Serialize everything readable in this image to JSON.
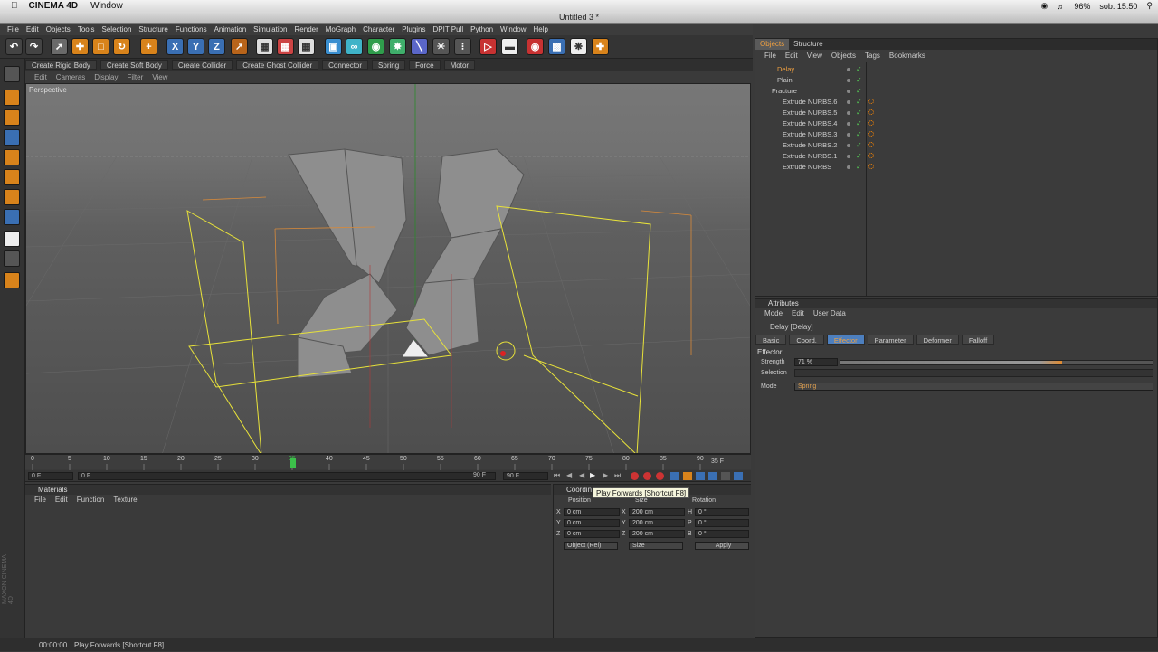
{
  "mac_menu": {
    "app": "CINEMA 4D",
    "window": "Window",
    "battery": "96%",
    "clock": "sob. 15:50"
  },
  "window_title": "Untitled 3 *",
  "main_menu": [
    "File",
    "Edit",
    "Objects",
    "Tools",
    "Selection",
    "Structure",
    "Functions",
    "Animation",
    "Simulation",
    "Render",
    "MoGraph",
    "Character",
    "Plugins",
    "DPIT Pull",
    "Python",
    "Window",
    "Help"
  ],
  "dynamics_bar": [
    "Create Rigid Body",
    "Create Soft Body",
    "Create Collider",
    "Create Ghost Collider",
    "Connector",
    "Spring",
    "Force",
    "Motor"
  ],
  "viewport": {
    "menu": [
      "Edit",
      "Cameras",
      "Display",
      "Filter",
      "View"
    ],
    "label": "Perspective"
  },
  "timeline": {
    "ticks": [
      "0",
      "5",
      "10",
      "15",
      "20",
      "25",
      "30",
      "35",
      "40",
      "45",
      "50",
      "55",
      "60",
      "65",
      "70",
      "75",
      "80",
      "85",
      "90"
    ],
    "current_frame": "35 F",
    "start_field": "0 F",
    "min_field": "0 F",
    "max_field": "90 F",
    "end_field": "90 F"
  },
  "materials": {
    "title": "Materials",
    "menu": [
      "File",
      "Edit",
      "Function",
      "Texture"
    ]
  },
  "coordinates": {
    "title": "Coordin",
    "headers": {
      "position": "Position",
      "size": "Size",
      "rotation": "Rotation"
    },
    "rows": [
      {
        "axis": "X",
        "pos": "0 cm",
        "saxis": "X",
        "size": "200 cm",
        "raxis": "H",
        "rot": "0 °"
      },
      {
        "axis": "Y",
        "pos": "0 cm",
        "saxis": "Y",
        "size": "200 cm",
        "raxis": "P",
        "rot": "0 °"
      },
      {
        "axis": "Z",
        "pos": "0 cm",
        "saxis": "Z",
        "size": "200 cm",
        "raxis": "B",
        "rot": "0 °"
      }
    ],
    "mode": "Object (Rel)",
    "size_mode": "Size",
    "apply": "Apply"
  },
  "tooltip": "Play Forwards [Shortcut F8]",
  "object_manager": {
    "tabs": [
      "Objects",
      "Structure"
    ],
    "menu": [
      "File",
      "Edit",
      "View",
      "Objects",
      "Tags",
      "Bookmarks"
    ],
    "items": [
      {
        "name": "Delay",
        "indent": 0
      },
      {
        "name": "Plain",
        "indent": 0
      },
      {
        "name": "Fracture",
        "indent": 0
      },
      {
        "name": "Extrude NURBS.6",
        "indent": 1
      },
      {
        "name": "Extrude NURBS.5",
        "indent": 1
      },
      {
        "name": "Extrude NURBS.4",
        "indent": 1
      },
      {
        "name": "Extrude NURBS.3",
        "indent": 1
      },
      {
        "name": "Extrude NURBS.2",
        "indent": 1
      },
      {
        "name": "Extrude NURBS.1",
        "indent": 1
      },
      {
        "name": "Extrude NURBS",
        "indent": 1
      }
    ]
  },
  "attributes": {
    "title": "Attributes",
    "menu": [
      "Mode",
      "Edit",
      "User Data"
    ],
    "object": "Delay [Delay]",
    "tabs": [
      "Basic",
      "Coord.",
      "Effector",
      "Parameter",
      "Deformer",
      "Falloff"
    ],
    "section": "Effector",
    "strength_label": "Strength",
    "strength_value": "71 %",
    "strength_fraction": 0.71,
    "selection_label": "Selection",
    "mode_label": "Mode",
    "mode_value": "Spring"
  },
  "status": {
    "time": "00:00:00",
    "message": "Play Forwards [Shortcut F8]"
  },
  "brand": "MAXON CINEMA 4D"
}
